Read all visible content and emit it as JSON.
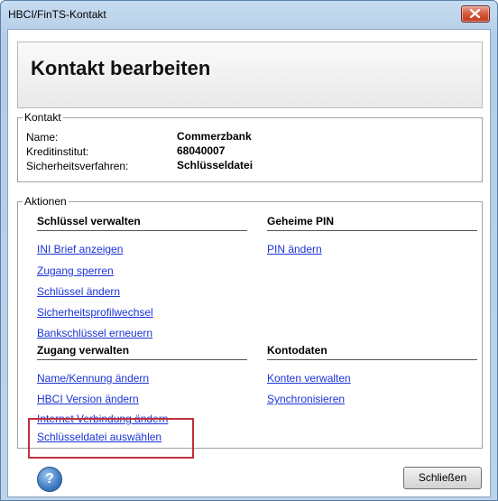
{
  "window": {
    "title": "HBCI/FinTS-Kontakt"
  },
  "header": {
    "title": "Kontakt bearbeiten"
  },
  "contact": {
    "legend": "Kontakt",
    "rows": [
      {
        "label": "Name:",
        "value": "Commerzbank"
      },
      {
        "label": "Kreditinstitut:",
        "value": "68040007"
      },
      {
        "label": "Sicherheitsverfahren:",
        "value": "Schlüsseldatei"
      }
    ]
  },
  "actions": {
    "legend": "Aktionen",
    "key_section": {
      "title": "Schlüssel verwalten",
      "links": [
        "INI Brief anzeigen",
        "Zugang sperren",
        "Schlüssel ändern",
        "Sicherheitsprofilwechsel",
        "Bankschlüssel erneuern"
      ]
    },
    "pin_section": {
      "title": "Geheime PIN",
      "links": [
        "PIN ändern"
      ]
    },
    "access_section": {
      "title": "Zugang verwalten",
      "links": [
        "Name/Kennung ändern",
        "HBCI Version ändern",
        "Internet Verbindung ändern",
        "Schlüsseldatei auswählen"
      ]
    },
    "account_section": {
      "title": "Kontodaten",
      "links": [
        "Konten verwalten",
        "Synchronisieren"
      ]
    }
  },
  "footer": {
    "help_glyph": "?",
    "close_label": "Schließen"
  },
  "icons": {
    "close": "close-x-icon",
    "help": "help-icon"
  },
  "colors": {
    "link": "#1a33d6",
    "highlight": "#c0303a",
    "close_button": "#c43b1f"
  }
}
